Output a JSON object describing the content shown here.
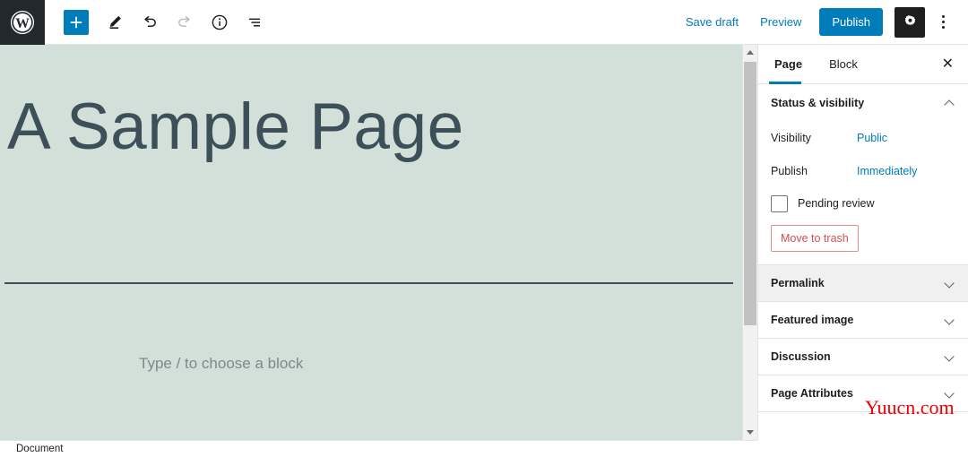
{
  "header": {
    "logo_icon": "wordpress-logo-icon",
    "tools": [
      {
        "name": "add-block-button",
        "icon": "plus-icon",
        "label": "+",
        "state": "primary"
      },
      {
        "name": "edit-tools-button",
        "icon": "pencil-icon",
        "label": "",
        "state": "default"
      },
      {
        "name": "undo-button",
        "icon": "undo-arrow-icon",
        "label": "",
        "state": "default"
      },
      {
        "name": "redo-button",
        "icon": "redo-arrow-icon",
        "label": "",
        "state": "disabled"
      },
      {
        "name": "details-button",
        "icon": "info-circle-icon",
        "label": "",
        "state": "default"
      },
      {
        "name": "list-view-button",
        "icon": "list-view-icon",
        "label": "",
        "state": "default"
      }
    ],
    "save_draft_label": "Save draft",
    "preview_label": "Preview",
    "publish_label": "Publish",
    "settings_icon": "gear-icon",
    "more_icon": "kebab-menu-icon",
    "accent_color": "#007cba"
  },
  "canvas": {
    "background_color": "#d3e0da",
    "post_title": "A Sample Page",
    "block_placeholder": "Type / to choose a block"
  },
  "sidebar": {
    "tabs": [
      {
        "label": "Page",
        "active": true
      },
      {
        "label": "Block",
        "active": false
      }
    ],
    "close_icon": "close-icon",
    "close_label": "✕",
    "status_panel": {
      "title": "Status & visibility",
      "chevron": "chevron-up-icon",
      "rows": [
        {
          "label": "Visibility",
          "value": "Public"
        },
        {
          "label": "Publish",
          "value": "Immediately"
        }
      ],
      "pending_review_label": "Pending review",
      "pending_review_checked": false,
      "trash_label": "Move to trash",
      "trash_color": "#d94f4f"
    },
    "panels": [
      {
        "label": "Permalink",
        "chevron": "chevron-down-icon",
        "hover": true
      },
      {
        "label": "Featured image",
        "chevron": "chevron-down-icon",
        "hover": false
      },
      {
        "label": "Discussion",
        "chevron": "chevron-down-icon",
        "hover": false
      },
      {
        "label": "Page Attributes",
        "chevron": "chevron-down-icon",
        "hover": false
      }
    ]
  },
  "watermark": {
    "text": "Yuucn.com",
    "color": "#f00000"
  },
  "footer": {
    "breadcrumb": "Document"
  }
}
